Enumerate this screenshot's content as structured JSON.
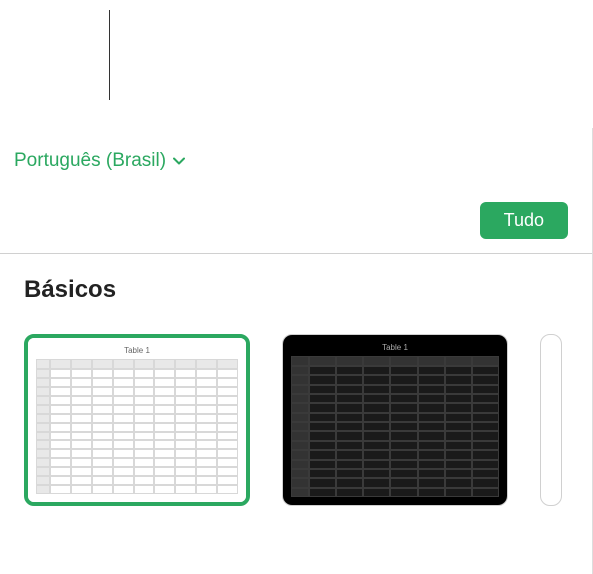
{
  "header": {
    "language": "Português (Brasil)",
    "filter_button": "Tudo"
  },
  "content": {
    "category_title": "Básicos",
    "templates": [
      {
        "label": "Table 1",
        "theme": "light",
        "selected": true
      },
      {
        "label": "Table 1",
        "theme": "dark",
        "selected": false
      }
    ]
  }
}
